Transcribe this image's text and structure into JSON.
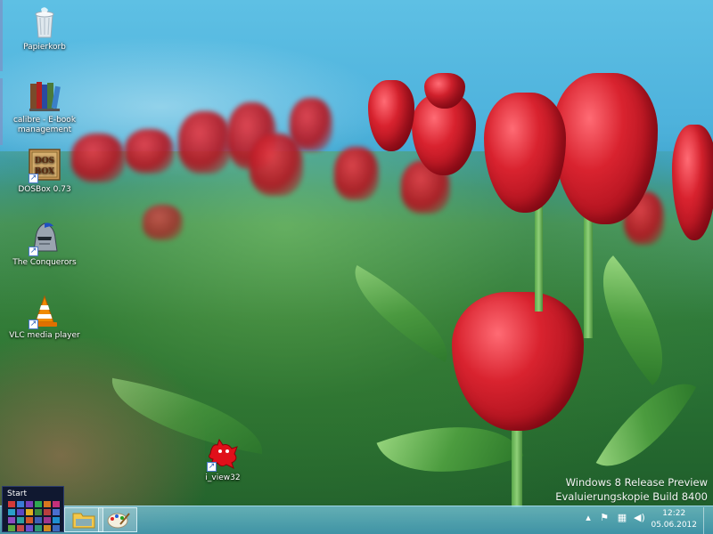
{
  "desktop": {
    "icons": [
      {
        "label": "Papierkorb",
        "icon": "recycle-bin-icon"
      },
      {
        "label": "calibre - E-book management",
        "icon": "calibre-books-icon"
      },
      {
        "label": "DOSBox 0.73",
        "icon": "dosbox-icon"
      },
      {
        "label": "The Conquerors",
        "icon": "knight-helmet-icon"
      },
      {
        "label": "VLC media player",
        "icon": "vlc-cone-icon"
      },
      {
        "label": "i_view32",
        "icon": "irfanview-cat-icon"
      }
    ],
    "dosbox_glyph": "DOSBOX"
  },
  "watermark": {
    "line1": "Windows 8 Release Preview",
    "line2": "Evaluierungskopie Build 8400"
  },
  "taskbar": {
    "start_label": "Start",
    "pinned": [
      {
        "name": "file-explorer",
        "icon": "folder-icon"
      },
      {
        "name": "paint",
        "icon": "paint-palette-icon"
      }
    ],
    "tray": {
      "icons": [
        "show-hidden-icons-icon",
        "flag-icon",
        "network-icon",
        "speaker-icon"
      ],
      "time": "12:22",
      "date": "05.06.2012"
    }
  },
  "colors": {
    "start_tiles": [
      "#d33a3a",
      "#3b7bd4",
      "#7a3fb8",
      "#2fa84f",
      "#d8761f",
      "#c4307a",
      "#2a9fc9",
      "#5a48c4",
      "#e0b020",
      "#3c8a3c",
      "#b83f3f",
      "#4a6fd0",
      "#8c4bc0",
      "#2aa0a0",
      "#d0582a",
      "#3f5fb5",
      "#a0368c",
      "#1e8fd0",
      "#5fa83a",
      "#c44a4a",
      "#6a4fcf",
      "#2e9a70",
      "#d08a20",
      "#3a6ac0"
    ]
  }
}
